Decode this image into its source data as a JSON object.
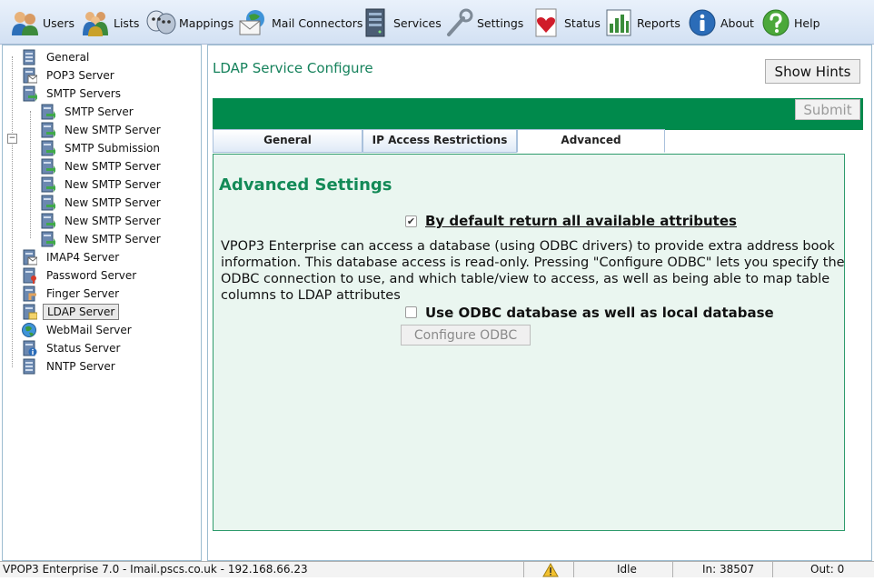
{
  "toolbar": {
    "items": [
      {
        "label": "Users",
        "icon": "users-icon"
      },
      {
        "label": "Lists",
        "icon": "lists-icon"
      },
      {
        "label": "Mappings",
        "icon": "mappings-icon"
      },
      {
        "label": "Mail Connectors",
        "icon": "mail-connectors-icon"
      },
      {
        "label": "Services",
        "icon": "services-icon"
      },
      {
        "label": "Settings",
        "icon": "settings-icon"
      },
      {
        "label": "Status",
        "icon": "status-icon"
      },
      {
        "label": "Reports",
        "icon": "reports-icon"
      },
      {
        "label": "About",
        "icon": "about-icon"
      },
      {
        "label": "Help",
        "icon": "help-icon"
      }
    ]
  },
  "tree": {
    "items": [
      {
        "label": "General"
      },
      {
        "label": "POP3 Server"
      },
      {
        "label": "SMTP Servers"
      },
      {
        "label": "SMTP Server"
      },
      {
        "label": "New SMTP Server"
      },
      {
        "label": "SMTP Submission"
      },
      {
        "label": "New SMTP Server"
      },
      {
        "label": "New SMTP Server"
      },
      {
        "label": "New SMTP Server"
      },
      {
        "label": "New SMTP Server"
      },
      {
        "label": "New SMTP Server"
      },
      {
        "label": "IMAP4 Server"
      },
      {
        "label": "Password Server"
      },
      {
        "label": "Finger Server"
      },
      {
        "label": "LDAP Server"
      },
      {
        "label": "WebMail Server"
      },
      {
        "label": "Status Server"
      },
      {
        "label": "NNTP Server"
      }
    ],
    "selected": "LDAP Server"
  },
  "main": {
    "title": "LDAP Service Configure",
    "show_hints": "Show Hints",
    "submit": "Submit",
    "tabs": [
      {
        "label": "General"
      },
      {
        "label": "IP Access Restrictions"
      },
      {
        "label": "Advanced"
      }
    ],
    "active_tab": "Advanced",
    "heading": "Advanced Settings",
    "checkbox1": {
      "label": "By default return all available attributes",
      "checked": true
    },
    "description": "VPOP3 Enterprise can access a database (using ODBC drivers) to provide extra address book information. This database access is read-only. Pressing \"Configure ODBC\" lets you specify the ODBC connection to use, and which table/view to access, as well as being able to map table columns to LDAP attributes",
    "checkbox2": {
      "label": "Use ODBC database as well as local database",
      "checked": false
    },
    "configure_button": "Configure ODBC"
  },
  "statusbar": {
    "server": "VPOP3 Enterprise 7.0 - Imail.pscs.co.uk - 192.168.66.23",
    "state": "Idle",
    "in": "In: 38507",
    "out": "Out: 0"
  },
  "colors": {
    "accent": "#008a4c",
    "heading": "#138a57",
    "panel_bg": "#eaf6f0"
  }
}
